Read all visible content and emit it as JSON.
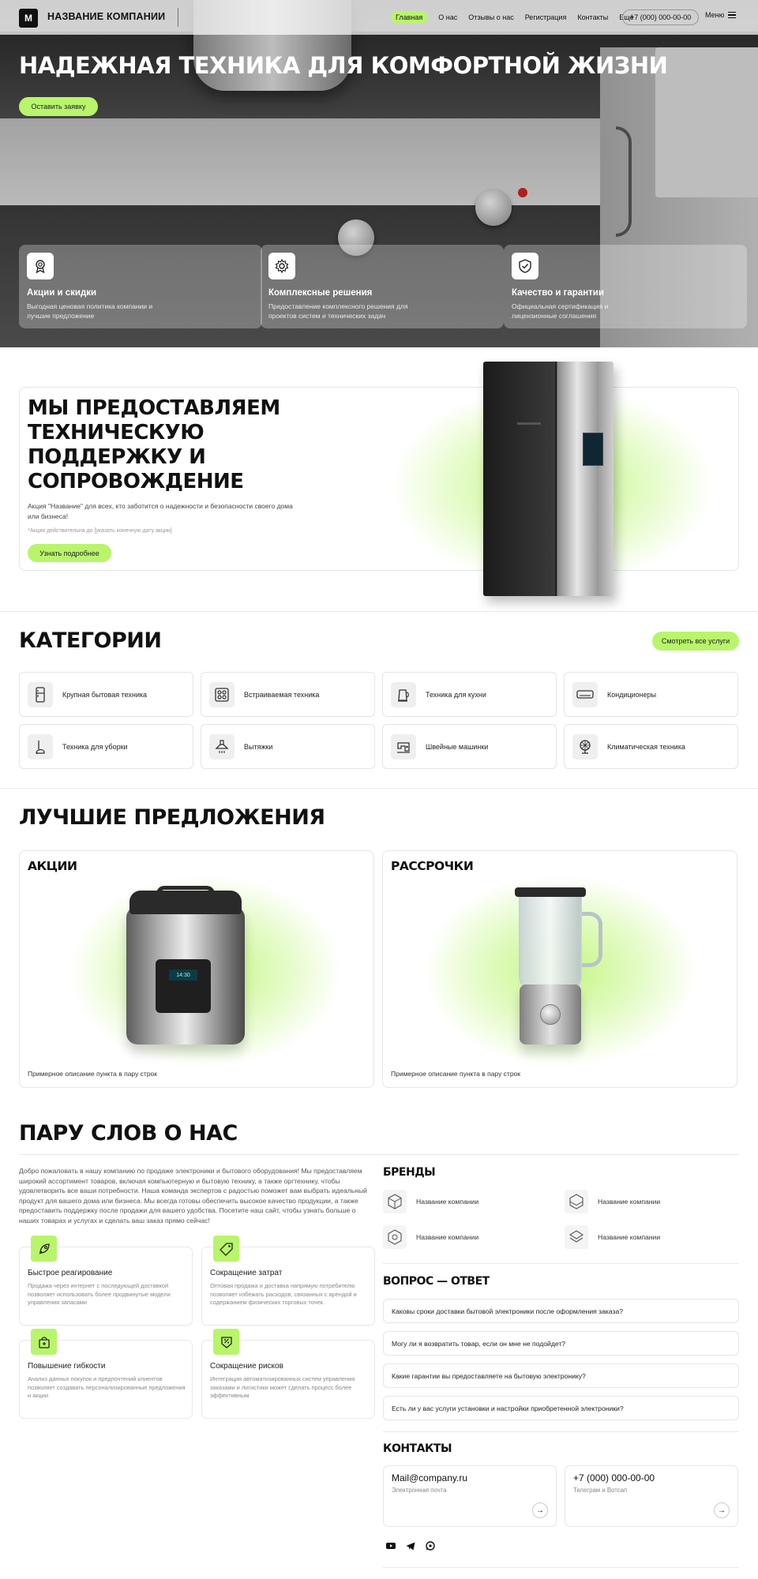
{
  "nav": {
    "logo": "M",
    "company": "Название компании",
    "links": [
      "Главная",
      "О нас",
      "Отзывы о нас",
      "Регистрация",
      "Контакты",
      "Ещё"
    ],
    "phone": "+7 (000) 000-00-00",
    "menu": "Меню"
  },
  "hero": {
    "title": "Надежная техника для комфортной жизни",
    "cta": "Оставить заявку",
    "features": [
      {
        "icon": "award-icon",
        "title": "Акции и скидки",
        "text": "Выгодная ценовая политика компании и лучшие предложение"
      },
      {
        "icon": "gear-icon",
        "title": "Комплексные решения",
        "text": "Предоставление комплексного решения для проектов систем и технических задач"
      },
      {
        "icon": "shield-check-icon",
        "title": "Качество и гарантии",
        "text": "Официальная сертификация и лицензионные соглашения"
      }
    ]
  },
  "promo": {
    "title": "Мы предоставляем техническую поддержку и сопровождение",
    "text": "Акция \"Название\" для всех, кто заботится о надежности и безопасности своего дома или бизнеса!",
    "note": "*Акция действительна до [указать конечную дату акции]",
    "button": "Узнать подробнее"
  },
  "categories": {
    "title": "Категории",
    "view_all": "Смотреть все услуги",
    "items": [
      {
        "icon": "fridge-icon",
        "label": "Крупная бытовая техника"
      },
      {
        "icon": "cooktop-icon",
        "label": "Встраиваемая техника"
      },
      {
        "icon": "kettle-icon",
        "label": "Техника для кухни"
      },
      {
        "icon": "air-conditioner-icon",
        "label": "Кондиционеры"
      },
      {
        "icon": "vacuum-icon",
        "label": "Техника для уборки"
      },
      {
        "icon": "hood-icon",
        "label": "Вытяжки"
      },
      {
        "icon": "sewing-machine-icon",
        "label": "Швейные машинки"
      },
      {
        "icon": "fan-icon",
        "label": "Климатическая техника"
      }
    ]
  },
  "offers": {
    "title": "Лучшие предложения",
    "cards": [
      {
        "title": "Акции",
        "text": "Примерное описание пункта в пару строк",
        "lcd": "14:30"
      },
      {
        "title": "Рассрочки",
        "text": "Примерное описание пункта в пару строк"
      }
    ]
  },
  "about": {
    "title": "Пару слов о нас",
    "text": "Добро пожаловать в нашу компанию по продаже электроники и бытового оборудования! Мы предоставляем широкий ассортимент товаров, включая компьютерную и бытовую технику, а также оргтехнику, чтобы удовлетворить все ваши потребности. Наша команда экспертов с радостью поможет вам выбрать идеальный продукт для вашего дома или бизнеса. Мы всегда готовы обеспечить высокое качество продукции, а также предоставить поддержку после продажи для вашего удобства. Посетите наш сайт, чтобы узнать больше о наших товарах и услугах и сделать ваш заказ прямо сейчас!",
    "advantages": [
      {
        "icon": "rocket-icon",
        "title": "Быстрое реагирование",
        "text": "Продажа через интернет с последующей доставкой позволяет использовать более продвинутые модели управления запасами"
      },
      {
        "icon": "price-tag-icon",
        "title": "Сокращение затрат",
        "text": "Оптовая продажа и доставка напрямую потребителю позволяет избежать расходов, связанных с арендой и содержанием физических торговых точек."
      },
      {
        "icon": "shopping-bag-icon",
        "title": "Повышение гибкости",
        "text": "Анализ данных покупок и предпочтений клиентов позволяет создавать персонализированные предложения и акции"
      },
      {
        "icon": "discount-icon",
        "title": "Сокращение рисков",
        "text": "Интеграция автоматизированных систем управления заказами и логистики может сделать процесс более эффективным"
      }
    ]
  },
  "brands": {
    "title": "Бренды",
    "items": [
      "Название компании",
      "Название компании",
      "Название компании",
      "Название компании"
    ]
  },
  "faq": {
    "title": "Вопрос — ответ",
    "items": [
      "Каковы сроки доставки бытовой электроники после оформления заказа?",
      "Могу ли я возвратить товар, если он мне не подойдет?",
      "Какие гарантии вы предоставляете на бытовую электронику?",
      "Есть ли у вас услуги установки и настройки приобретенной электроники?"
    ]
  },
  "contacts": {
    "title": "Контакты",
    "email": "Mail@company.ru",
    "email_label": "Электронная почта",
    "phone": "+7 (000) 000-00-00",
    "phone_label": "Телеграм и Вотсап",
    "arrow": "→"
  },
  "colors": {
    "accent": "#b8f56b",
    "text": "#111111",
    "border": "#e6e6e6"
  }
}
